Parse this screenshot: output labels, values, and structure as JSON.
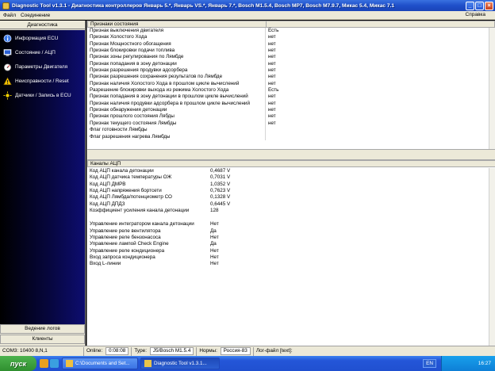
{
  "window": {
    "title": "Diagnostic Tool v1.3.1 - Диагностика контроллеров Январь 5.*, Январь VS.*, Январь 7.*, Bosch M1.5.4, Bosch MP7, Bosch M7.9.7, Микас 5.4, Микас 7.1",
    "minimize": "_",
    "maximize": "□",
    "close": "×"
  },
  "menu": {
    "file": "Файл",
    "connection": "Соединение",
    "help": "Справка"
  },
  "sidebar": {
    "header": "Диагностика",
    "items": [
      {
        "label": "Информация ECU",
        "icon": "info-icon"
      },
      {
        "label": "Состояние / АЦП",
        "icon": "monitor-icon"
      },
      {
        "label": "Параметры Двигателя",
        "icon": "gauge-icon"
      },
      {
        "label": "Неисправности / Reset",
        "icon": "warning-icon"
      },
      {
        "label": "Датчики / Запись в ECU",
        "icon": "sensor-icon"
      }
    ],
    "logs": "Ведение логов",
    "clients": "Клиенты"
  },
  "states": {
    "header": "Признаки состояния",
    "rows": [
      {
        "name": "Признак выключения двигателя",
        "value": "Есть"
      },
      {
        "name": "Признак Холостого Хода",
        "value": "нет"
      },
      {
        "name": "Признак Мощностного обогащения",
        "value": "нет"
      },
      {
        "name": "Признак блокировки подачи топлива",
        "value": "нет"
      },
      {
        "name": "Признак зоны регулирования по Лямбде",
        "value": "нет"
      },
      {
        "name": "Признак попадания в зону детонации",
        "value": "нет"
      },
      {
        "name": "Признак разрешения продувки адсорбера",
        "value": "нет"
      },
      {
        "name": "Признак разрешения сохранения результатов по Лямбде",
        "value": "нет"
      },
      {
        "name": "Признак наличия Холостого Хода в прошлом цикле вычислений",
        "value": "нет"
      },
      {
        "name": "Разрешение блокировки выхода из режима Холостого Хода",
        "value": "Есть"
      },
      {
        "name": "Признак попадания в зону детонации в прошлом цикле вычислений",
        "value": "нет"
      },
      {
        "name": "Признак наличия продувки адсорбера в прошлом цикле вычислений",
        "value": "нет"
      },
      {
        "name": "Признак обнаружения детонации",
        "value": "нет"
      },
      {
        "name": "Признак прошлого состояния Лябды",
        "value": "нет"
      },
      {
        "name": "Признак текущего состояния Лямбды",
        "value": "нет"
      },
      {
        "name": "Флаг готовности Лямбды",
        "value": ""
      },
      {
        "name": "Флаг разрешения нагрева Лямбды",
        "value": ""
      }
    ]
  },
  "adc": {
    "header": "Каналы АЦП",
    "rows": [
      {
        "name": "Код АЦП канала детонации",
        "value": "0,4687 V"
      },
      {
        "name": "Код АЦП датчика температуры ОЖ",
        "value": "0,7031 V"
      },
      {
        "name": "Код АЦП ДМРВ",
        "value": "1,0352 V"
      },
      {
        "name": "Код АЦП напряжения бортсети",
        "value": "0,7623 V"
      },
      {
        "name": "Код АЦП Лямбда/потенциометр СО",
        "value": "0,1328 V"
      },
      {
        "name": "Код АЦП ДПДЗ",
        "value": "0,6445 V"
      },
      {
        "name": "Коэффициент усиления канала детонации",
        "value": "128"
      }
    ],
    "controls": [
      {
        "name": "Управление интегратором канала детонации",
        "value": "Нет"
      },
      {
        "name": "Управление реле вентилятора",
        "value": "Да"
      },
      {
        "name": "Управление реле бензонасоса",
        "value": "Нет"
      },
      {
        "name": "Управление лампой Check Engine",
        "value": "Да"
      },
      {
        "name": "Управление реле кондиционера",
        "value": "Нет"
      },
      {
        "name": "Вход запроса кондиционера",
        "value": "Нет"
      },
      {
        "name": "Вход L-линии",
        "value": "Нет"
      }
    ]
  },
  "status": {
    "port": "COM3: 10400 8,N,1",
    "online_label": "Online:",
    "online_time": "0:08:08",
    "type_label": "Type:",
    "type_value": "J5/Bosch M1.5.4",
    "norms_label": "Нормы:",
    "norms_value": "Россия-83",
    "log_label": "Лог-файл [text]:"
  },
  "taskbar": {
    "start": "пуск",
    "tasks": [
      "C:\\Documents and Set...",
      "Diagnostic Tool v1.3.1..."
    ],
    "lang": "EN",
    "clock": "16:27"
  },
  "colors": {
    "accent": "#2050d0",
    "nav_bg": "#06063a",
    "panel": "#ece9d8"
  }
}
